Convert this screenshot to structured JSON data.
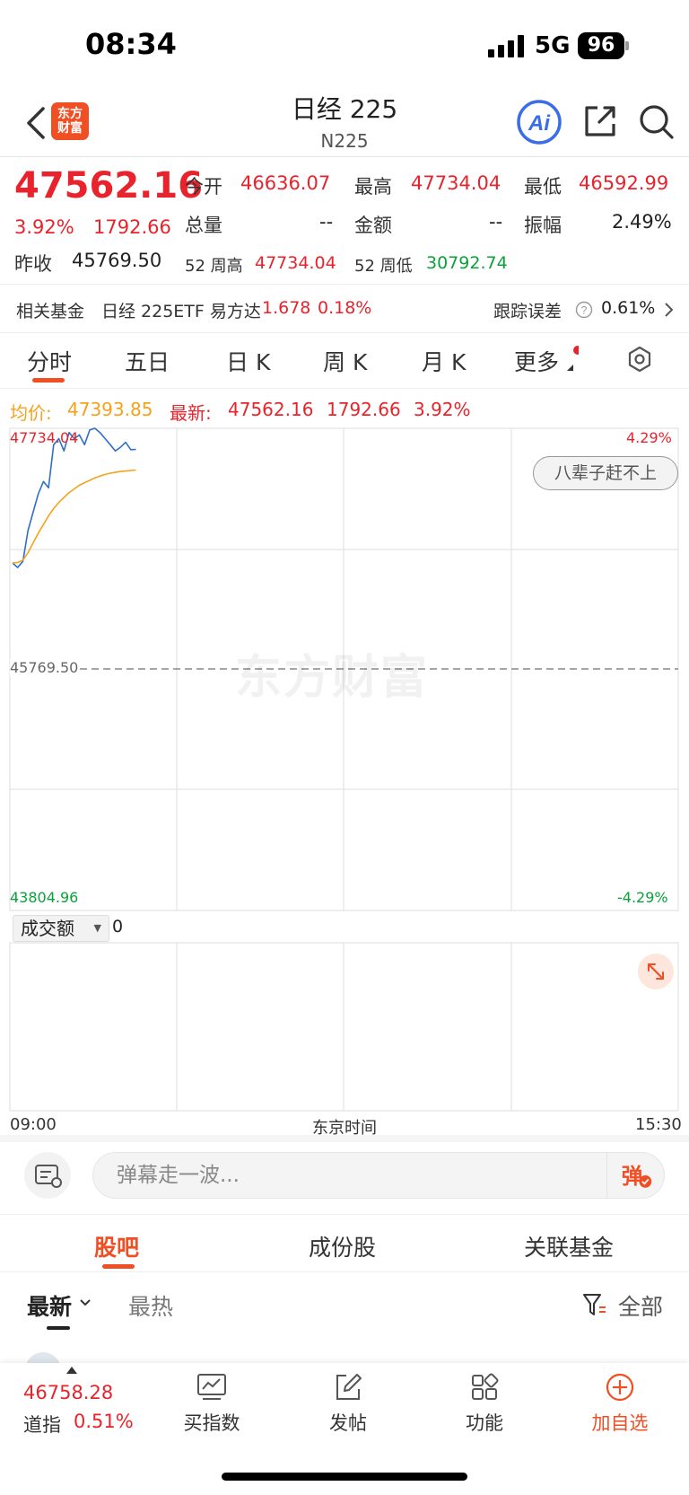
{
  "status_bar": {
    "time": "08:34",
    "network": "5G",
    "battery": "96"
  },
  "header": {
    "logo_text_1": "东方",
    "logo_text_2": "财富",
    "title": "日经 225",
    "subtitle": "N225"
  },
  "quote": {
    "price": "47562.16",
    "change_pct": "3.92%",
    "change": "1792.66",
    "prev_close_label": "昨收",
    "prev_close": "45769.50",
    "open_label": "今开",
    "open": "46636.07",
    "high_label": "最高",
    "high": "47734.04",
    "low_label": "最低",
    "low": "46592.99",
    "volume_label": "总量",
    "volume": "--",
    "amount_label": "金额",
    "amount": "--",
    "amplitude_label": "振幅",
    "amplitude": "2.49%",
    "wk52_high_label": "52 周高",
    "wk52_high": "47734.04",
    "wk52_low_label": "52 周低",
    "wk52_low": "30792.74"
  },
  "fund": {
    "label": "相关基金",
    "name": "日经 225ETF 易方达",
    "price": "1.678",
    "change": "0.18%",
    "tracking_label": "跟踪误差",
    "tracking_value": "0.61%"
  },
  "chart_tabs": [
    {
      "label": "分时",
      "active": true
    },
    {
      "label": "五日"
    },
    {
      "label": "日 K"
    },
    {
      "label": "周 K"
    },
    {
      "label": "月 K"
    },
    {
      "label": "更多"
    }
  ],
  "chart_info": {
    "avg_label": "均价:",
    "avg_value": "47393.85",
    "latest_label": "最新:",
    "latest_value": "47562.16",
    "latest_change": "1792.66",
    "latest_pct": "3.92%"
  },
  "chart_data": {
    "type": "line",
    "y_top_label": "47734.04",
    "y_mid_label": "45769.50",
    "y_bottom_label": "43804.96",
    "pct_top_label": "4.29%",
    "pct_bottom_label": "-4.29%",
    "ylim": [
      43804.96,
      47734.04
    ],
    "xlabel_left": "09:00",
    "xlabel_center": "东京时间",
    "xlabel_right": "15:30",
    "series": [
      {
        "color": "#2f6fc9",
        "values": [
          46636.07,
          46600,
          46650,
          46900,
          47050,
          47200,
          47300,
          47250,
          47600,
          47650,
          47550,
          47700,
          47650,
          47680,
          47600,
          47720,
          47734.04,
          47700,
          47650,
          47600,
          47550,
          47580,
          47620,
          47560,
          47562.16
        ]
      },
      {
        "color": "#f5a21b",
        "values": [
          46636.07,
          46640,
          46660,
          46720,
          46800,
          46880,
          46950,
          47020,
          47080,
          47130,
          47170,
          47210,
          47240,
          47270,
          47290,
          47310,
          47330,
          47345,
          47358,
          47368,
          47375,
          47382,
          47386,
          47390,
          47393.85
        ]
      }
    ]
  },
  "watermark": "东方财富",
  "badge": "八辈子赶不上",
  "volume": {
    "selector": "成交额",
    "value": "0"
  },
  "danmaku": {
    "placeholder": "弹幕走一波...",
    "send": "弹"
  },
  "section_tabs": [
    "股吧",
    "成份股",
    "关联基金"
  ],
  "feed_tabs": {
    "latest": "最新",
    "hot": "最热",
    "filter": "全部"
  },
  "bottom_bar": {
    "index_value": "46758.28",
    "index_name": "道指",
    "index_pct": "0.51%",
    "items": [
      "买指数",
      "发帖",
      "功能",
      "加自选"
    ]
  }
}
